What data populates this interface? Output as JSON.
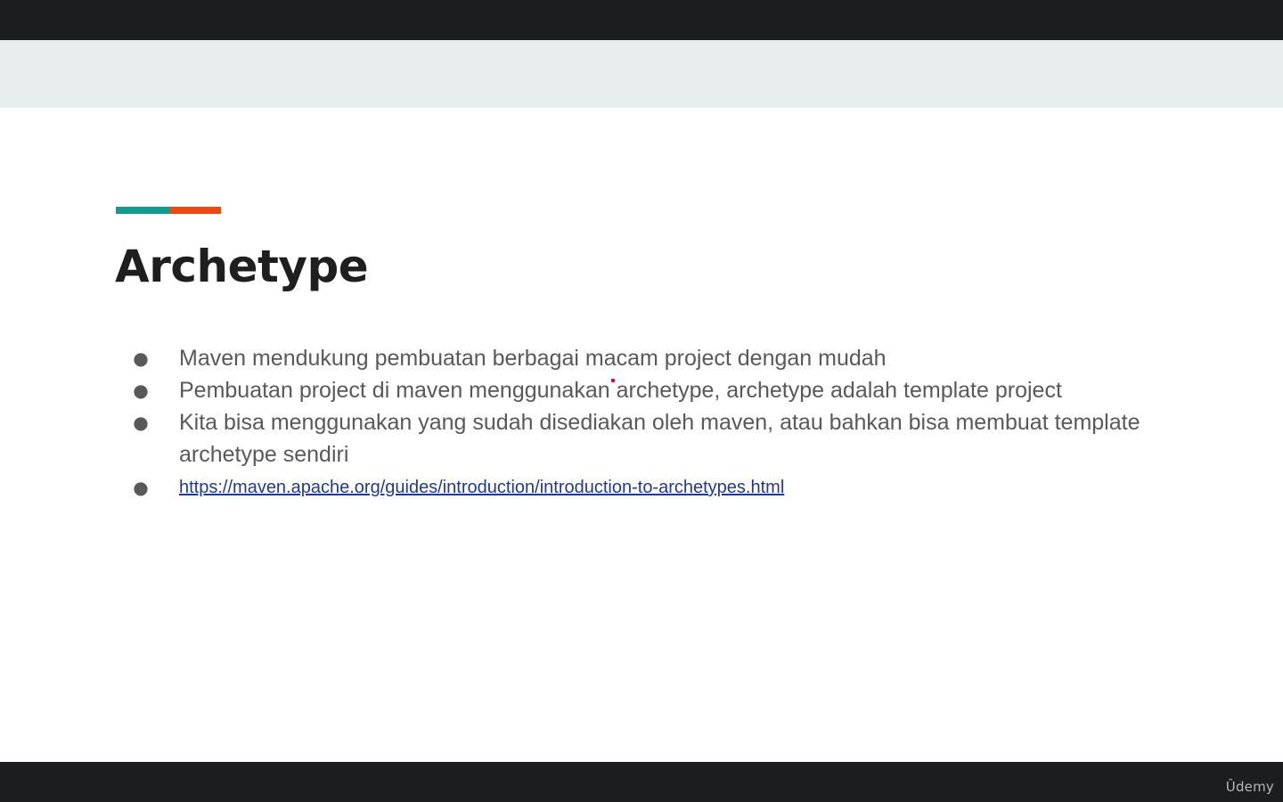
{
  "colors": {
    "letterbox": "#1c1d1f",
    "header_band": "#e8eded",
    "accent_teal": "#0f9d8e",
    "accent_orange": "#f0490f",
    "title": "#1f1f1f",
    "body_text": "#595959",
    "link": "#1f3a93"
  },
  "slide": {
    "title": "Archetype",
    "bullets": [
      {
        "text": "Maven mendukung pembuatan berbagai macam project dengan mudah"
      },
      {
        "text": "Pembuatan project di maven menggunakan archetype, archetype adalah template project"
      },
      {
        "text": "Kita bisa menggunakan yang sudah disediakan oleh maven, atau bahkan bisa membuat template archetype sendiri"
      }
    ],
    "link": {
      "text": "https://maven.apache.org/guides/introduction/introduction-to-archetypes.html"
    },
    "bullet_glyph": "●"
  },
  "watermark": {
    "text": "Ûdemy"
  }
}
